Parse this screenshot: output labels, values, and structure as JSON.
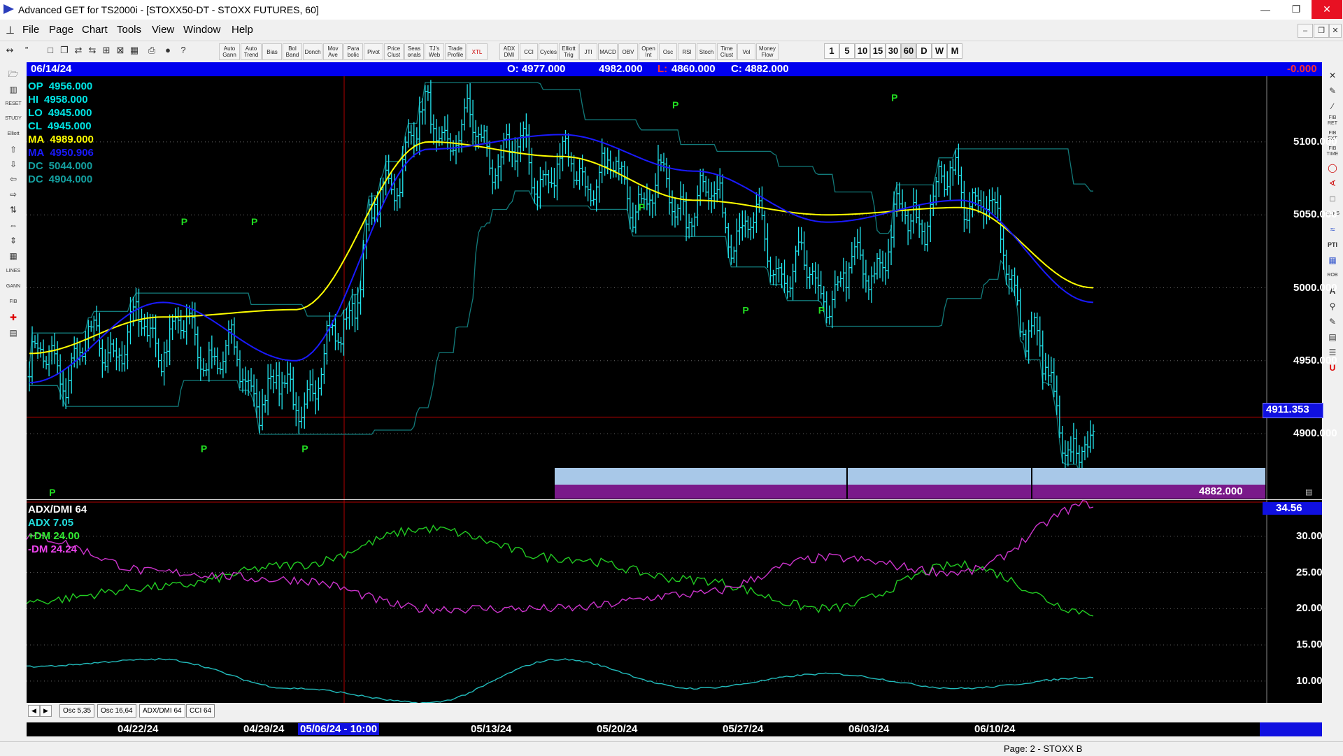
{
  "window": {
    "title": "Advanced GET for TS2000i - [STOXX50-DT - STOXX FUTURES, 60]"
  },
  "menu": [
    "File",
    "Page",
    "Chart",
    "Tools",
    "View",
    "Window",
    "Help"
  ],
  "toolbar": {
    "study_buttons": [
      "Auto Gann",
      "Auto Trend",
      "Bias",
      "Bol Band",
      "Donch",
      "Mov Ave",
      "Para bolic",
      "Pivot",
      "Price Clust",
      "Seas onals",
      "TJ's Web",
      "Trade Profile",
      "XTL",
      "ADX DMI",
      "CCI",
      "Cycles",
      "Elliott Trig",
      "JTI",
      "MACD",
      "OBV",
      "Open Int",
      "Osc",
      "RSI",
      "Stoch",
      "Time Clust",
      "Vol",
      "Money Flow"
    ],
    "timeframes": [
      "1",
      "5",
      "10",
      "15",
      "30",
      "60",
      "D",
      "W",
      "M"
    ]
  },
  "info_bar": {
    "date": "06/14/24",
    "open": "O: 4977.000",
    "high": "4982.000",
    "low_label": "L:",
    "low": "4860.000",
    "close": "C: 4882.000",
    "change": "-0.000"
  },
  "readouts": [
    {
      "label": "OP",
      "value": "4956.000",
      "color": "#00e5e5"
    },
    {
      "label": "HI",
      "value": "4958.000",
      "color": "#00e5e5"
    },
    {
      "label": "LO",
      "value": "4945.000",
      "color": "#00e5e5"
    },
    {
      "label": "CL",
      "value": "4945.000",
      "color": "#00e5e5"
    },
    {
      "label": "MA",
      "value": "4989.000",
      "color": "#ffff00"
    },
    {
      "label": "MA",
      "value": "4950.906",
      "color": "#1a1aff"
    },
    {
      "label": "DC",
      "value": "5044.000",
      "color": "#14a0a0"
    },
    {
      "label": "DC",
      "value": "4904.000",
      "color": "#14a0a0"
    }
  ],
  "price_axis": [
    "5100.000",
    "5050.000",
    "5000.000",
    "4950.000",
    "4900.000"
  ],
  "price_markers": {
    "crosshair": "4911.353",
    "last": "4882.000"
  },
  "pivot_label": "P",
  "oscillator": {
    "title": "ADX/DMI 64",
    "adx": "ADX 7.05",
    "plus_dm": "+DM 24.00",
    "minus_dm": "-DM 24.24",
    "axis": [
      "30.00",
      "25.00",
      "20.00",
      "15.00",
      "10.00"
    ],
    "marker": "34.56"
  },
  "tabs": [
    "Osc 5,35",
    "Osc 16,64",
    "ADX/DMI 64",
    "CCI 64"
  ],
  "dates": [
    "04/22/24",
    "04/29/24",
    "05/06/24 - 10:00",
    "05/13/24",
    "05/20/24",
    "05/27/24",
    "06/03/24",
    "06/10/24"
  ],
  "status": "Page: 2 - STOXX B",
  "chart_data": [
    {
      "type": "bar",
      "title": "STOXX50-DT - STOXX FUTURES, 60",
      "x": [
        "04/22/24",
        "04/29/24",
        "05/06/24",
        "05/13/24",
        "05/20/24",
        "05/27/24",
        "06/03/24",
        "06/10/24",
        "06/14/24"
      ],
      "close_approx": [
        4945,
        4970,
        4925,
        5110,
        5080,
        5060,
        5000,
        5070,
        4882
      ],
      "series": [
        {
          "name": "MA",
          "color": "#ffff00",
          "values": [
            4955,
            4980,
            4985,
            5100,
            5090,
            5060,
            5050,
            5055,
            5000
          ]
        },
        {
          "name": "MA",
          "color": "#1a1aff",
          "values": [
            4935,
            4990,
            4950,
            5095,
            5105,
            5080,
            5045,
            5060,
            4990
          ]
        }
      ],
      "ylim": [
        4855,
        5145
      ],
      "last": 4882.0
    },
    {
      "type": "line",
      "title": "ADX/DMI 64",
      "series": [
        {
          "name": "+DM",
          "color": "#22cc22",
          "values": [
            21,
            23,
            26,
            31,
            27,
            24,
            20,
            26,
            19.5
          ]
        },
        {
          "name": "-DM",
          "color": "#cc33cc",
          "values": [
            30,
            25,
            24,
            20,
            20,
            22,
            27,
            25,
            34.5
          ]
        },
        {
          "name": "ADX",
          "color": "#22bbbb",
          "values": [
            12,
            13,
            9,
            7,
            13,
            9,
            11,
            9,
            10.5
          ]
        }
      ],
      "ylim": [
        7,
        35
      ]
    }
  ]
}
